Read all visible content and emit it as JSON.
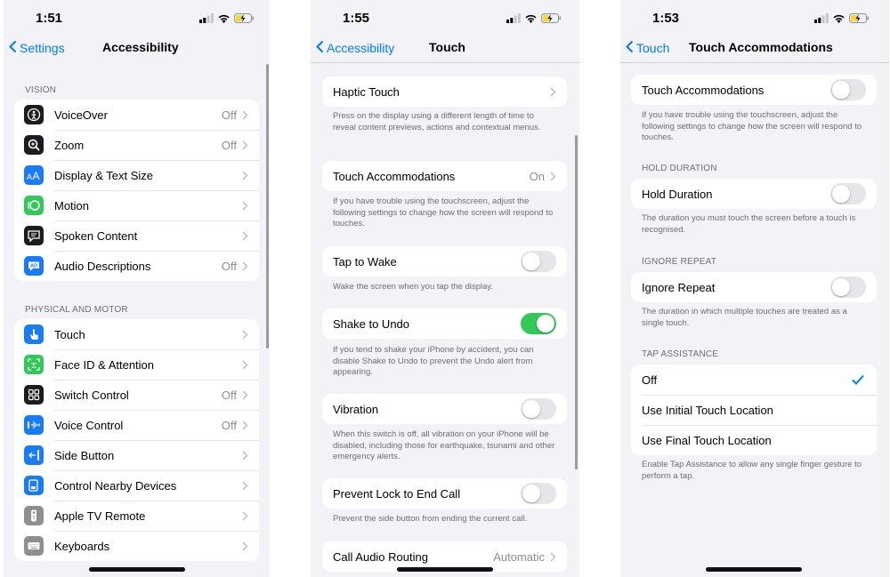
{
  "colors": {
    "accent": "#007aff",
    "toggle_on": "#34c759",
    "toggle_off": "#e5e5ea",
    "battery_charging": "#f2d73c"
  },
  "screen1": {
    "time": "1:51",
    "back_label": "Settings",
    "title": "Accessibility",
    "vision_header": "VISION",
    "vision_items": [
      {
        "label": "VoiceOver",
        "value": "Off",
        "icon": "voiceover-icon",
        "color": "#1c1c1e"
      },
      {
        "label": "Zoom",
        "value": "Off",
        "icon": "zoom-icon",
        "color": "#1c1c1e"
      },
      {
        "label": "Display & Text Size",
        "value": "",
        "icon": "text-size-icon",
        "color": "#1a7cf5"
      },
      {
        "label": "Motion",
        "value": "",
        "icon": "motion-icon",
        "color": "#34c759"
      },
      {
        "label": "Spoken Content",
        "value": "",
        "icon": "speech-bubble-icon",
        "color": "#1c1c1e"
      },
      {
        "label": "Audio Descriptions",
        "value": "Off",
        "icon": "audio-description-icon",
        "color": "#1a7cf5"
      }
    ],
    "physical_header": "PHYSICAL AND MOTOR",
    "physical_items": [
      {
        "label": "Touch",
        "value": "",
        "icon": "hand-icon",
        "color": "#1a7cf5"
      },
      {
        "label": "Face ID & Attention",
        "value": "",
        "icon": "face-id-icon",
        "color": "#34c759"
      },
      {
        "label": "Switch Control",
        "value": "Off",
        "icon": "switch-control-icon",
        "color": "#1c1c1e"
      },
      {
        "label": "Voice Control",
        "value": "Off",
        "icon": "voice-control-icon",
        "color": "#1a7cf5"
      },
      {
        "label": "Side Button",
        "value": "",
        "icon": "side-button-icon",
        "color": "#1a7cf5"
      },
      {
        "label": "Control Nearby Devices",
        "value": "",
        "icon": "nearby-devices-icon",
        "color": "#1a7cf5"
      },
      {
        "label": "Apple TV Remote",
        "value": "",
        "icon": "tv-remote-icon",
        "color": "#8e8e93"
      },
      {
        "label": "Keyboards",
        "value": "",
        "icon": "keyboard-icon",
        "color": "#8e8e93"
      }
    ]
  },
  "screen2": {
    "time": "1:55",
    "back_label": "Accessibility",
    "title": "Touch",
    "haptic_label": "Haptic Touch",
    "haptic_footer": "Press on the display using a different length of time to reveal content previews, actions and contextual menus.",
    "accommodations_label": "Touch Accommodations",
    "accommodations_value": "On",
    "accommodations_footer": "If you have trouble using the touchscreen, adjust the following settings to change how the screen will respond to touches.",
    "tap_to_wake_label": "Tap to Wake",
    "tap_to_wake_on": false,
    "tap_to_wake_footer": "Wake the screen when you tap the display.",
    "shake_label": "Shake to Undo",
    "shake_on": true,
    "shake_footer": "If you tend to shake your iPhone by accident, you can disable Shake to Undo to prevent the Undo alert from appearing.",
    "vibration_label": "Vibration",
    "vibration_on": false,
    "vibration_footer": "When this switch is off, all vibration on your iPhone will be disabled, including those for earthquake, tsunami and other emergency alerts.",
    "prevent_lock_label": "Prevent Lock to End Call",
    "prevent_lock_on": false,
    "prevent_lock_footer": "Prevent the side button from ending the current call.",
    "call_audio_label": "Call Audio Routing",
    "call_audio_value": "Automatic"
  },
  "screen3": {
    "time": "1:53",
    "back_label": "Touch",
    "title": "Touch Accommodations",
    "accommodations_label": "Touch Accommodations",
    "accommodations_on": false,
    "accommodations_footer": "If you have trouble using the touchscreen, adjust the following settings to change how the screen will respond to touches.",
    "hold_header": "HOLD DURATION",
    "hold_label": "Hold Duration",
    "hold_on": false,
    "hold_footer": "The duration you must touch the screen before a touch is recognised.",
    "ignore_header": "IGNORE REPEAT",
    "ignore_label": "Ignore Repeat",
    "ignore_on": false,
    "ignore_footer": "The duration in which multiple touches are treated as a single touch.",
    "tap_header": "TAP ASSISTANCE",
    "tap_options": [
      "Off",
      "Use Initial Touch Location",
      "Use Final Touch Location"
    ],
    "tap_selected": "Off",
    "tap_footer": "Enable Tap Assistance to allow any single finger gesture to perform a tap."
  }
}
